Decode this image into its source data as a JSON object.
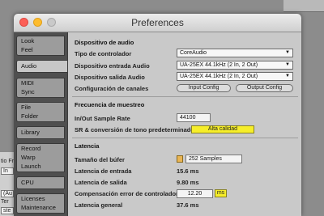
{
  "window": {
    "title": "Preferences"
  },
  "background": {
    "label_top": "tio Fr",
    "field_in": "In",
    "field_aux": "(Au",
    "label_ter": "Ter",
    "field_aux2": "ste"
  },
  "tabs": [
    {
      "line1": "Look",
      "line2": "Feel"
    },
    {
      "line1": "Audio",
      "line2": ""
    },
    {
      "line1": "MIDI",
      "line2": "Sync"
    },
    {
      "line1": "File",
      "line2": "Folder"
    },
    {
      "line1": "Library",
      "line2": ""
    },
    {
      "line1": "Record",
      "line2": "Warp",
      "line3": "Launch"
    },
    {
      "line1": "CPU",
      "line2": ""
    },
    {
      "line1": "Licenses",
      "line2": "Maintenance"
    }
  ],
  "audio_device": {
    "section": "Dispositivo de audio",
    "driver_label": "Tipo de controlador",
    "driver_value": "CoreAudio",
    "input_label": "Dispositivo entrada Audio",
    "input_value": "UA-25EX 44.1kHz (2 In, 2 Out)",
    "output_label": "Dispositivo salida Audio",
    "output_value": "UA-25EX 44.1kHz (2 In, 2 Out)",
    "channels_label": "Configuración de canales",
    "input_config": "Input Config",
    "output_config": "Output Config"
  },
  "sample_rate": {
    "section": "Frecuencia de muestreo",
    "rate_label": "In/Out Sample Rate",
    "rate_value": "44100",
    "sr_label": "SR & conversión de tono predeterminados",
    "sr_value": "Alta calidad"
  },
  "latency": {
    "section": "Latencia",
    "buffer_label": "Tamaño del búfer",
    "buffer_value": "252 Samples",
    "input_latency_label": "Latencia de entrada",
    "input_latency_value": "15.6 ms",
    "output_latency_label": "Latencia de salida",
    "output_latency_value": "9.80 ms",
    "compensation_label": "Compensación error de controlador",
    "compensation_value": "12.20",
    "compensation_unit": "ms",
    "overall_label": "Latencia general",
    "overall_value": "37.6 ms"
  },
  "colors": {
    "highlight_yellow": "#f6ee2a",
    "buffer_swatch": "#e9b554",
    "panel": "#c9c9c9",
    "tab_active": "#c7c7c7"
  },
  "icons": {
    "dropdown_arrow": "▼"
  }
}
